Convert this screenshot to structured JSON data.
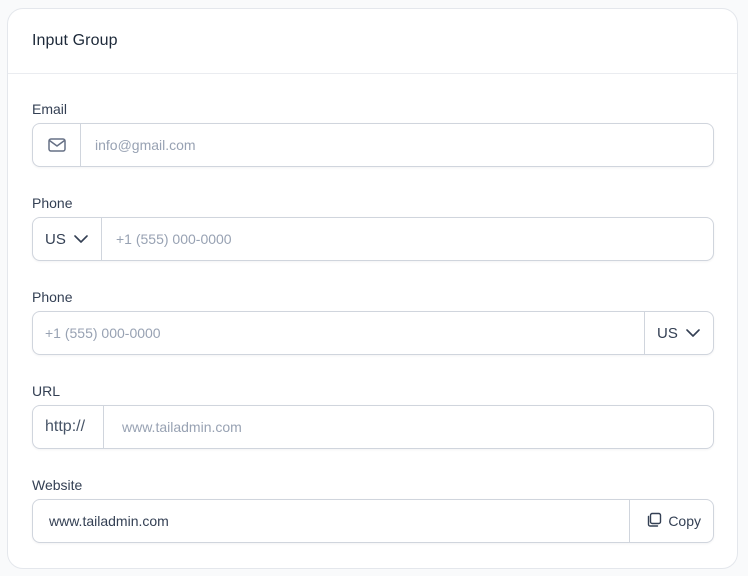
{
  "card": {
    "title": "Input Group"
  },
  "email": {
    "label": "Email",
    "icon": "mail-icon",
    "placeholder": "info@gmail.com"
  },
  "phone_left": {
    "label": "Phone",
    "country": "US",
    "placeholder": "+1 (555) 000-0000"
  },
  "phone_right": {
    "label": "Phone",
    "country": "US",
    "placeholder": "+1 (555) 000-0000"
  },
  "url": {
    "label": "URL",
    "prefix": "http://",
    "placeholder": "www.tailadmin.com"
  },
  "website": {
    "label": "Website",
    "value": "www.tailadmin.com",
    "copy_label": "Copy",
    "icon": "copy-icon"
  }
}
